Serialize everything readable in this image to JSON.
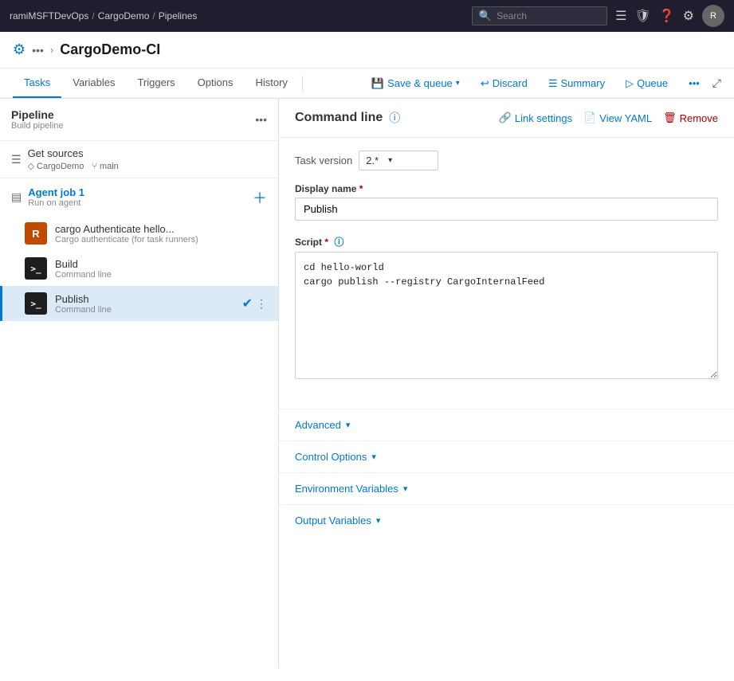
{
  "topNav": {
    "breadcrumb": [
      "ramiMSFTDevOps",
      "CargoDemo",
      "Pipelines"
    ],
    "search": {
      "placeholder": "Search"
    }
  },
  "pageHeader": {
    "title": "CargoDemo-CI",
    "icon": "🔧"
  },
  "tabs": {
    "items": [
      "Tasks",
      "Variables",
      "Triggers",
      "Options",
      "History"
    ],
    "active": "Tasks"
  },
  "toolbar": {
    "saveQueue": "Save & queue",
    "discard": "Discard",
    "summary": "Summary",
    "queue": "Queue"
  },
  "leftPanel": {
    "pipeline": {
      "title": "Pipeline",
      "subtitle": "Build pipeline"
    },
    "getSources": {
      "label": "Get sources",
      "repo": "CargoDemo",
      "branch": "main"
    },
    "agentJob": {
      "name": "Agent job 1",
      "subtitle": "Run on agent"
    },
    "tasks": [
      {
        "id": "cargo-auth",
        "name": "cargo Authenticate hello...",
        "subtitle": "Cargo authenticate (for task runners)",
        "iconType": "rust",
        "iconLabel": "R",
        "selected": false
      },
      {
        "id": "build",
        "name": "Build",
        "subtitle": "Command line",
        "iconType": "black",
        "iconLabel": ">_",
        "selected": false
      },
      {
        "id": "publish",
        "name": "Publish",
        "subtitle": "Command line",
        "iconType": "black",
        "iconLabel": ">_",
        "selected": true
      }
    ]
  },
  "rightPanel": {
    "title": "Command line",
    "linkSettings": "Link settings",
    "viewYaml": "View YAML",
    "remove": "Remove",
    "taskVersion": {
      "label": "Task version",
      "value": "2.*"
    },
    "displayName": {
      "label": "Display name",
      "required": true,
      "value": "Publish"
    },
    "script": {
      "label": "Script",
      "required": true,
      "line1": "cd hello-world",
      "line2": "cargo publish --registry CargoInternalFeed"
    },
    "sections": [
      {
        "id": "advanced",
        "label": "Advanced"
      },
      {
        "id": "control-options",
        "label": "Control Options"
      },
      {
        "id": "environment-variables",
        "label": "Environment Variables"
      },
      {
        "id": "output-variables",
        "label": "Output Variables"
      }
    ]
  }
}
